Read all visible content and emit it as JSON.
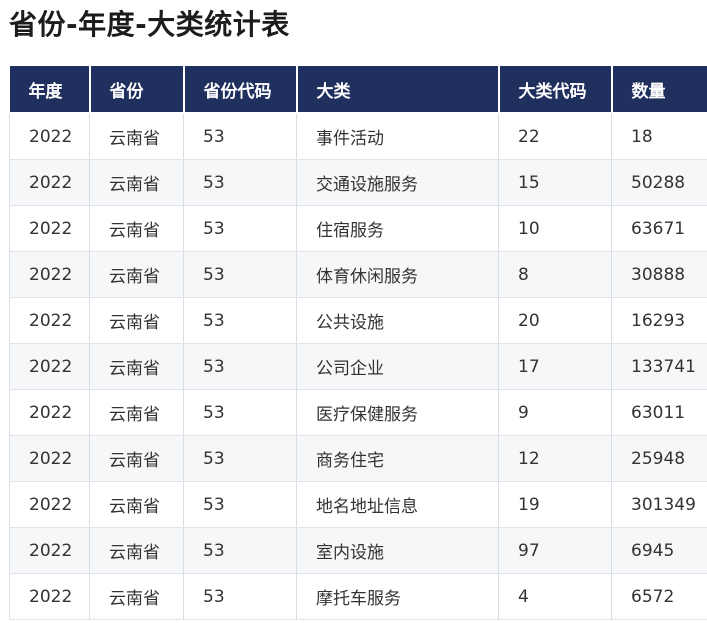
{
  "title": "省份-年度-大类统计表",
  "table": {
    "headers": [
      "年度",
      "省份",
      "省份代码",
      "大类",
      "大类代码",
      "数量"
    ],
    "rows": [
      [
        "2022",
        "云南省",
        "53",
        "事件活动",
        "22",
        "18"
      ],
      [
        "2022",
        "云南省",
        "53",
        "交通设施服务",
        "15",
        "50288"
      ],
      [
        "2022",
        "云南省",
        "53",
        "住宿服务",
        "10",
        "63671"
      ],
      [
        "2022",
        "云南省",
        "53",
        "体育休闲服务",
        "8",
        "30888"
      ],
      [
        "2022",
        "云南省",
        "53",
        "公共设施",
        "20",
        "16293"
      ],
      [
        "2022",
        "云南省",
        "53",
        "公司企业",
        "17",
        "133741"
      ],
      [
        "2022",
        "云南省",
        "53",
        "医疗保健服务",
        "9",
        "63011"
      ],
      [
        "2022",
        "云南省",
        "53",
        "商务住宅",
        "12",
        "25948"
      ],
      [
        "2022",
        "云南省",
        "53",
        "地名地址信息",
        "19",
        "301349"
      ],
      [
        "2022",
        "云南省",
        "53",
        "室内设施",
        "97",
        "6945"
      ],
      [
        "2022",
        "云南省",
        "53",
        "摩托车服务",
        "4",
        "6572"
      ]
    ]
  },
  "colors": {
    "header_bg": "#1f2f5e",
    "header_text": "#ffffff",
    "stripe": "#f6f7f9",
    "border": "#d9dde6"
  }
}
